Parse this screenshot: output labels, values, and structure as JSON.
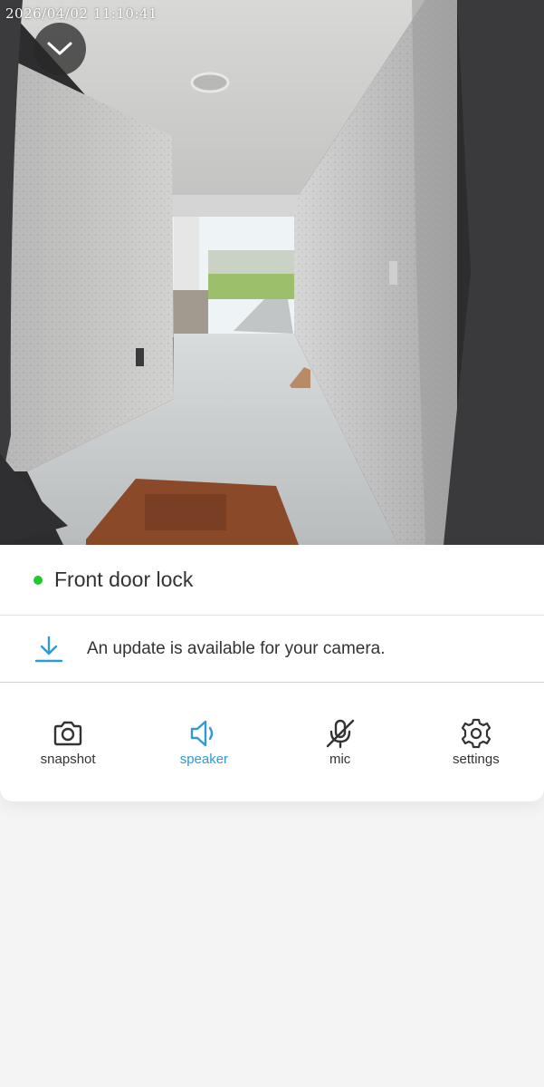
{
  "camera": {
    "timestamp": "2026/04/02 11:10:41"
  },
  "device": {
    "name": "Front door lock",
    "status_color": "#1fc92e"
  },
  "update": {
    "message": "An update is available for your camera.",
    "icon": "download-icon",
    "icon_color": "#2e9bd6"
  },
  "controls": [
    {
      "label": "snapshot",
      "icon": "camera-icon",
      "active": false
    },
    {
      "label": "speaker",
      "icon": "speaker-icon",
      "active": true
    },
    {
      "label": "mic",
      "icon": "mic-off-icon",
      "active": false
    },
    {
      "label": "settings",
      "icon": "gear-icon",
      "active": false
    }
  ],
  "colors": {
    "accent": "#2e9bd6",
    "text": "#333333",
    "background": "#f4f4f4"
  }
}
